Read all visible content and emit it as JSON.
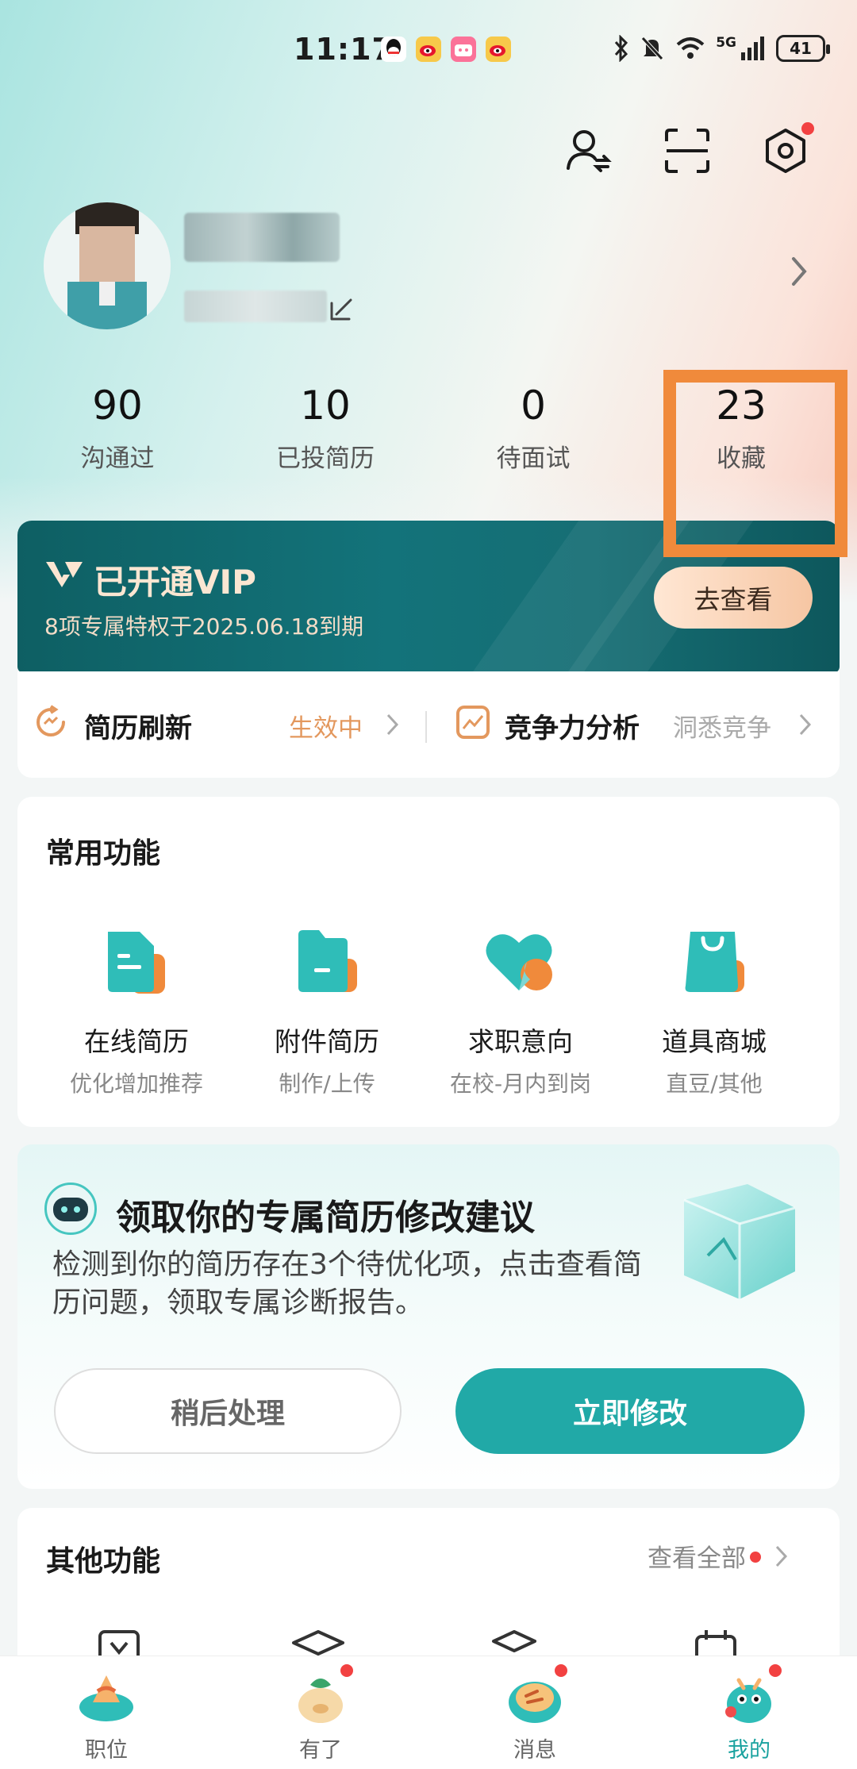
{
  "status_bar": {
    "time": "11:17",
    "battery": "41",
    "network": "5G",
    "notif_icons": [
      "qq-icon",
      "weibo-icon",
      "bilibili-icon",
      "weibo-icon"
    ]
  },
  "stats": [
    {
      "value": "90",
      "label": "沟通过"
    },
    {
      "value": "10",
      "label": "已投简历"
    },
    {
      "value": "0",
      "label": "待面试"
    },
    {
      "value": "23",
      "label": "收藏"
    }
  ],
  "vip": {
    "title": "已开通VIP",
    "subtitle": "8项专属特权于2025.06.18到期",
    "button": "去查看"
  },
  "quick_row": {
    "refresh_title": "简历刷新",
    "refresh_status": "生效中",
    "analysis_title": "竞争力分析",
    "analysis_status": "洞悉竞争"
  },
  "common_functions": {
    "title": "常用功能",
    "items": [
      {
        "title": "在线简历",
        "subtitle": "优化增加推荐"
      },
      {
        "title": "附件简历",
        "subtitle": "制作/上传"
      },
      {
        "title": "求职意向",
        "subtitle": "在校-月内到岗"
      },
      {
        "title": "道具商城",
        "subtitle": "直豆/其他"
      }
    ]
  },
  "advice": {
    "title": "领取你的专属简历修改建议",
    "description": "检测到你的简历存在3个待优化项，点击查看简历问题，领取专属诊断报告。",
    "later_button": "稍后处理",
    "now_button": "立即修改"
  },
  "other_functions": {
    "title": "其他功能",
    "view_all": "查看全部"
  },
  "bottom_nav": [
    {
      "label": "职位",
      "active": false
    },
    {
      "label": "有了",
      "active": false
    },
    {
      "label": "消息",
      "active": false
    },
    {
      "label": "我的",
      "active": true
    }
  ],
  "colors": {
    "accent": "#21a9a7",
    "highlight": "#f08a3b",
    "vip_bg": "#13737a",
    "badge": "#f24141",
    "refresh_status": "#e3985e"
  }
}
